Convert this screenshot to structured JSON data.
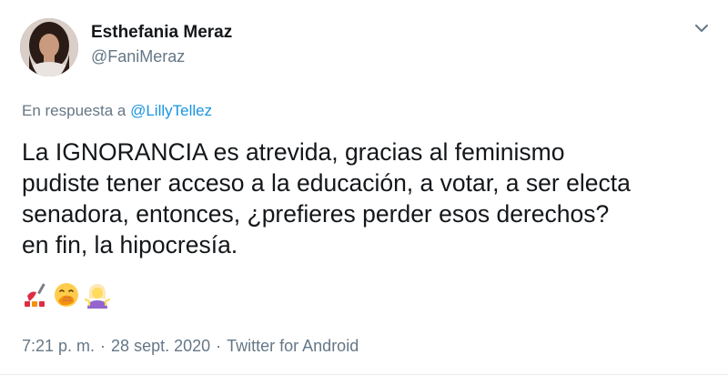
{
  "author": {
    "display_name": "Esthefania Meraz",
    "handle": "@FaniMeraz",
    "avatar_icon": "user-avatar"
  },
  "reply": {
    "prefix": "En respuesta a",
    "mention": "@LillyTellez"
  },
  "tweet": {
    "lines": [
      "La IGNORANCIA es atrevida, gracias al feminismo",
      "pudiste tener acceso a la educación, a votar, a ser electa",
      "senadora, entonces, ¿prefieres perder esos derechos?",
      "en fin, la hipocresía."
    ],
    "emojis": [
      "nail-polish-icon",
      "hand-over-mouth-icon",
      "woman-shrugging-icon"
    ]
  },
  "meta": {
    "time": "7:21 p. m.",
    "separator": "·",
    "date": "28 sept. 2020",
    "source": "Twitter for Android"
  },
  "colors": {
    "text": "#14171a",
    "secondary": "#657786",
    "link": "#1b95e0"
  },
  "menu": {
    "icon": "chevron-down-icon"
  }
}
